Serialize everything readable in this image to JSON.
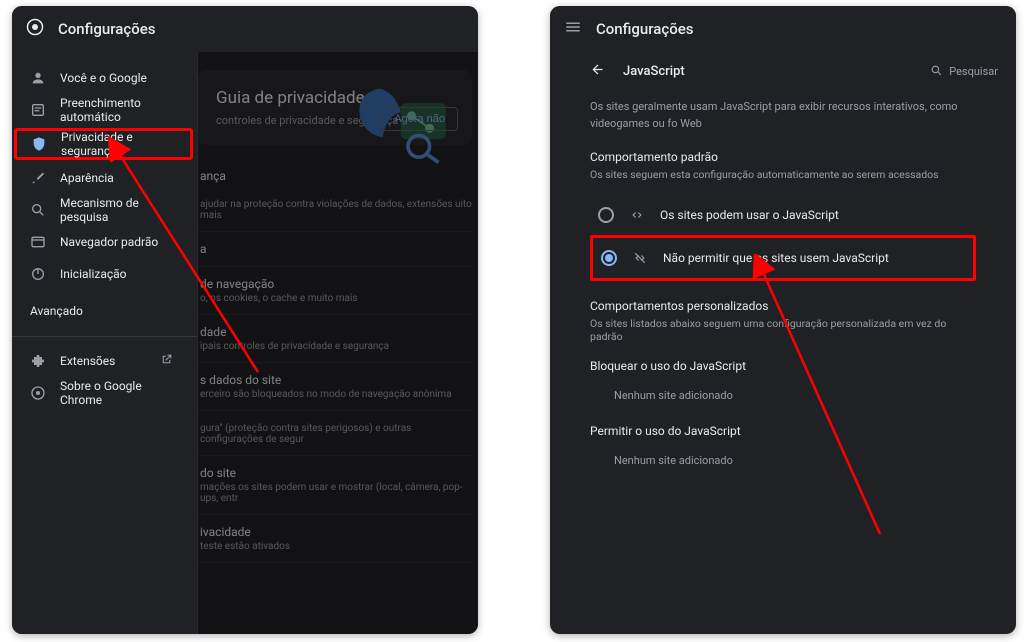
{
  "left": {
    "title": "Configurações",
    "sidebar": {
      "items": [
        {
          "label": "Você e o Google",
          "icon": "person"
        },
        {
          "label": "Preenchimento automático",
          "icon": "autofill"
        },
        {
          "label": "Privacidade e segurança",
          "icon": "shield",
          "highlight": true
        },
        {
          "label": "Aparência",
          "icon": "brush"
        },
        {
          "label": "Mecanismo de pesquisa",
          "icon": "search"
        },
        {
          "label": "Navegador padrão",
          "icon": "browser"
        },
        {
          "label": "Inicialização",
          "icon": "power"
        }
      ],
      "advanced": "Avançado",
      "extensions": "Extensões",
      "about": "Sobre o Google Chrome"
    },
    "main": {
      "guide": {
        "title": "Guia de privacidade",
        "subtitle": "controles de privacidade e segurança",
        "button": "Agora não"
      },
      "section_title": "ança",
      "rows": [
        {
          "title": "",
          "sub": "ajudar na proteção contra violações de dados, extensões\nuito mais"
        },
        {
          "title": "a",
          "sub": ""
        },
        {
          "title": "de navegação",
          "sub": "o, os cookies, o cache e muito mais"
        },
        {
          "title": "dade",
          "sub": "ipais controles de privacidade e segurança"
        },
        {
          "title": "s dados do site",
          "sub": "erceiro são bloqueados no modo de navegação anônima"
        },
        {
          "title": "",
          "sub": "gura\" (proteção contra sites perigosos) e outras configurações de segur"
        },
        {
          "title": "do site",
          "sub": "mações os sites podem usar e mostrar (local, câmera, pop-ups, entr"
        },
        {
          "title": "ivacidade",
          "sub": "teste estão ativados"
        }
      ]
    }
  },
  "right": {
    "title": "Configurações",
    "subheader": "JavaScript",
    "search": "Pesquisar",
    "description": "Os sites geralmente usam JavaScript para exibir recursos interativos, como videogames ou fo Web",
    "default_behavior": {
      "title": "Comportamento padrão",
      "subtitle": "Os sites seguem esta configuração automaticamente ao serem acessados",
      "options": [
        {
          "label": "Os sites podem usar o JavaScript",
          "selected": false
        },
        {
          "label": "Não permitir que os sites usem JavaScript",
          "selected": true,
          "highlight": true
        }
      ]
    },
    "custom": {
      "title": "Comportamentos personalizados",
      "subtitle": "Os sites listados abaixo seguem uma configuração personalizada em vez do padrão",
      "block": {
        "title": "Bloquear o uso do JavaScript",
        "empty": "Nenhum site adicionado"
      },
      "allow": {
        "title": "Permitir o uso do JavaScript",
        "empty": "Nenhum site adicionado"
      }
    }
  }
}
